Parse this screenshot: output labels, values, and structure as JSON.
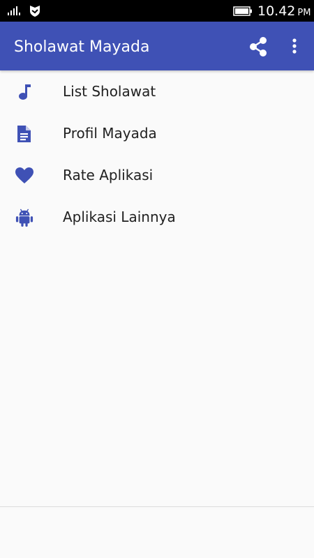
{
  "status_bar": {
    "time": "10.42",
    "ampm": "PM",
    "icons": [
      "signal-icon",
      "shield-icon",
      "battery-icon"
    ]
  },
  "app_bar": {
    "title": "Sholawat Mayada",
    "actions": [
      "share-icon",
      "more-vert-icon"
    ],
    "color": "#3f51b5"
  },
  "menu": {
    "items": [
      {
        "label": "List Sholawat",
        "icon": "music-note-icon"
      },
      {
        "label": "Profil Mayada",
        "icon": "document-icon"
      },
      {
        "label": "Rate Aplikasi",
        "icon": "heart-icon"
      },
      {
        "label": "Aplikasi Lainnya",
        "icon": "android-icon"
      }
    ],
    "icon_color": "#3f51b5",
    "text_color": "#212121"
  }
}
